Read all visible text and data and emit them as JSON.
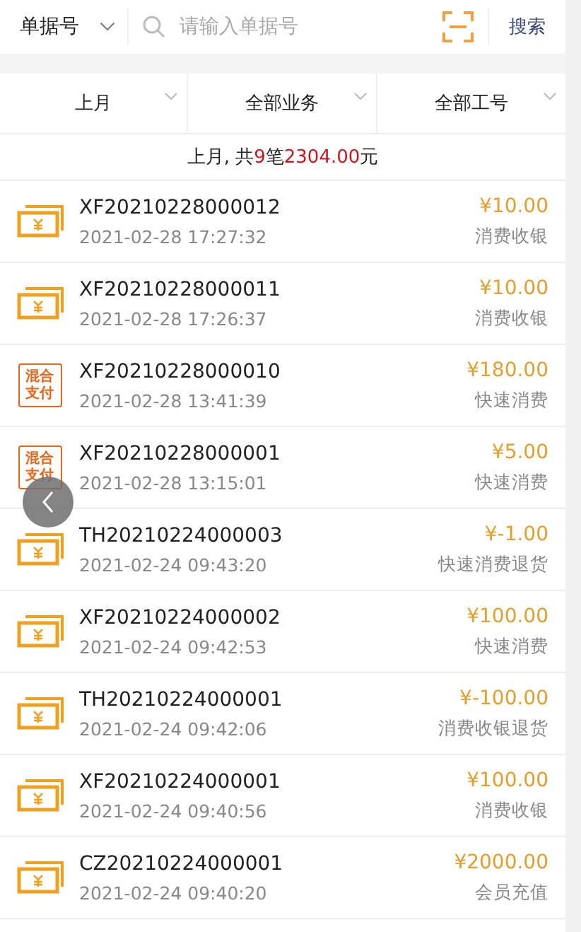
{
  "search_bar": {
    "type_select": "单据号",
    "placeholder": "请输入单据号",
    "search_button": "搜索"
  },
  "filters": [
    {
      "label": "上月"
    },
    {
      "label": "全部业务"
    },
    {
      "label": "全部工号"
    }
  ],
  "summary": {
    "prefix": "上月, 共",
    "count": "9",
    "mid": "笔",
    "amount": "2304.00",
    "suffix": "元"
  },
  "orders": [
    {
      "kind": "cash",
      "number": "XF20210228000012",
      "time": "2021-02-28 17:27:32",
      "amount": "¥10.00",
      "type": "消费收银"
    },
    {
      "kind": "cash",
      "number": "XF20210228000011",
      "time": "2021-02-28 17:26:37",
      "amount": "¥10.00",
      "type": "消费收银"
    },
    {
      "kind": "mixed",
      "badge": [
        "混合",
        "支付"
      ],
      "number": "XF20210228000010",
      "time": "2021-02-28 13:41:39",
      "amount": "¥180.00",
      "type": "快速消费"
    },
    {
      "kind": "mixed",
      "badge": [
        "混合",
        "支付"
      ],
      "number": "XF20210228000001",
      "time": "2021-02-28 13:15:01",
      "amount": "¥5.00",
      "type": "快速消费"
    },
    {
      "kind": "cash",
      "number": "TH20210224000003",
      "time": "2021-02-24 09:43:20",
      "amount": "¥-1.00",
      "type": "快速消费退货"
    },
    {
      "kind": "cash",
      "number": "XF20210224000002",
      "time": "2021-02-24 09:42:53",
      "amount": "¥100.00",
      "type": "快速消费"
    },
    {
      "kind": "cash",
      "number": "TH20210224000001",
      "time": "2021-02-24 09:42:06",
      "amount": "¥-100.00",
      "type": "消费收银退货"
    },
    {
      "kind": "cash",
      "number": "XF20210224000001",
      "time": "2021-02-24 09:40:56",
      "amount": "¥100.00",
      "type": "消费收银"
    },
    {
      "kind": "cash",
      "number": "CZ20210224000001",
      "time": "2021-02-24 09:40:20",
      "amount": "¥2000.00",
      "type": "会员充值"
    }
  ]
}
